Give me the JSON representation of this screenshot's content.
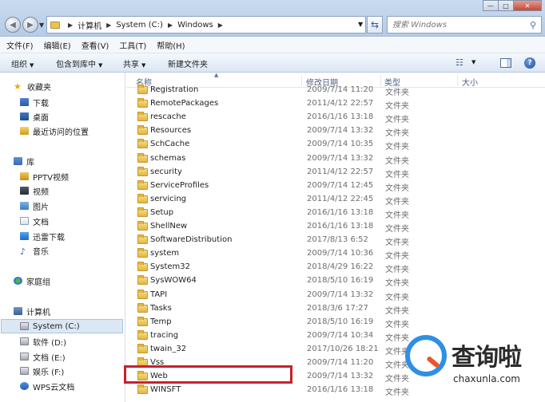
{
  "address": {
    "segments": [
      "计算机",
      "System (C:)",
      "Windows"
    ]
  },
  "search": {
    "placeholder": "搜索 Windows"
  },
  "window_controls": {
    "min": "—",
    "max": "□",
    "close": "✕"
  },
  "menu": [
    "文件(F)",
    "编辑(E)",
    "查看(V)",
    "工具(T)",
    "帮助(H)"
  ],
  "commands": {
    "organize": "组织",
    "include_library": "包含到库中",
    "share": "共享",
    "new_folder": "新建文件夹"
  },
  "nav": {
    "favorites": "收藏夹",
    "downloads": "下载",
    "desktop": "桌面",
    "recent": "最近访问的位置",
    "libraries": "库",
    "pptv": "PPTV视频",
    "videos": "视频",
    "pictures": "图片",
    "documents": "文档",
    "thunder": "迅雷下载",
    "music": "音乐",
    "homegroup": "家庭组",
    "computer": "计算机",
    "drive_c": "System (C:)",
    "drive_d": "软件 (D:)",
    "drive_e": "文档 (E:)",
    "drive_f": "娱乐 (F:)",
    "wps": "WPS云文档"
  },
  "columns": {
    "name": "名称",
    "modified": "修改日期",
    "type": "类型",
    "size": "大小"
  },
  "files": [
    {
      "name": "Registration",
      "date": "2009/7/14 11:20",
      "type": "文件夹"
    },
    {
      "name": "RemotePackages",
      "date": "2011/4/12 22:57",
      "type": "文件夹"
    },
    {
      "name": "rescache",
      "date": "2016/1/16 13:18",
      "type": "文件夹"
    },
    {
      "name": "Resources",
      "date": "2009/7/14 13:32",
      "type": "文件夹"
    },
    {
      "name": "SchCache",
      "date": "2009/7/14 10:35",
      "type": "文件夹"
    },
    {
      "name": "schemas",
      "date": "2009/7/14 13:32",
      "type": "文件夹"
    },
    {
      "name": "security",
      "date": "2011/4/12 22:57",
      "type": "文件夹"
    },
    {
      "name": "ServiceProfiles",
      "date": "2009/7/14 12:45",
      "type": "文件夹"
    },
    {
      "name": "servicing",
      "date": "2011/4/12 22:45",
      "type": "文件夹"
    },
    {
      "name": "Setup",
      "date": "2016/1/16 13:18",
      "type": "文件夹"
    },
    {
      "name": "ShellNew",
      "date": "2016/1/16 13:18",
      "type": "文件夹"
    },
    {
      "name": "SoftwareDistribution",
      "date": "2017/8/13 6:52",
      "type": "文件夹"
    },
    {
      "name": "system",
      "date": "2009/7/14 10:36",
      "type": "文件夹"
    },
    {
      "name": "System32",
      "date": "2018/4/29 16:22",
      "type": "文件夹"
    },
    {
      "name": "SysWOW64",
      "date": "2018/5/10 16:19",
      "type": "文件夹"
    },
    {
      "name": "TAPI",
      "date": "2009/7/14 13:32",
      "type": "文件夹"
    },
    {
      "name": "Tasks",
      "date": "2018/3/6 17:27",
      "type": "文件夹"
    },
    {
      "name": "Temp",
      "date": "2018/5/10 16:19",
      "type": "文件夹"
    },
    {
      "name": "tracing",
      "date": "2009/7/14 10:34",
      "type": "文件夹"
    },
    {
      "name": "twain_32",
      "date": "2017/10/26 18:21",
      "type": "文件夹"
    },
    {
      "name": "Vss",
      "date": "2009/7/14 11:20",
      "type": "文件夹"
    },
    {
      "name": "Web",
      "date": "2009/7/14 13:32",
      "type": "文件夹"
    },
    {
      "name": "WINSFT",
      "date": "2016/1/16 13:18",
      "type": "文件夹"
    }
  ],
  "watermark": {
    "title": "查询啦",
    "url": "chaxunla.com"
  },
  "icons": {
    "back": "back-arrow-icon",
    "forward": "forward-arrow-icon",
    "refresh": "refresh-icon",
    "search": "search-icon",
    "help": "help-icon",
    "folder": "folder-icon"
  },
  "highlight_color": "#c8202e"
}
